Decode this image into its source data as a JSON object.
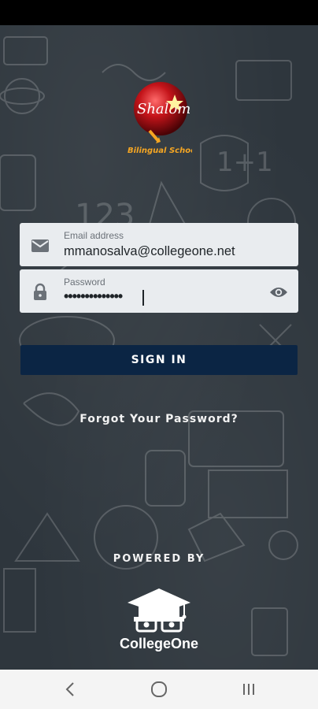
{
  "login": {
    "email_label": "Email address",
    "email_value": "mmanosalva@collegeone.net",
    "password_label": "Password",
    "password_value": "••••••••••••••",
    "sign_in_label": "SIGN IN",
    "forgot_label": "Forgot Your Password?"
  },
  "brand": {
    "school_logo_text": "Shalom",
    "school_logo_subtext": "Bilingual School",
    "powered_by_label": "POWERED BY",
    "vendor_name": "CollegeOne"
  },
  "icons": {
    "email_field": "mail-icon",
    "password_field": "lock-icon",
    "password_toggle": "eye-icon",
    "nav_back": "chevron-left-icon",
    "nav_home": "home-circle-icon",
    "nav_recent": "recent-apps-icon"
  },
  "colors": {
    "sign_in_button": "#0b2544",
    "field_background": "#e9ecef",
    "background": "#2e363d"
  }
}
